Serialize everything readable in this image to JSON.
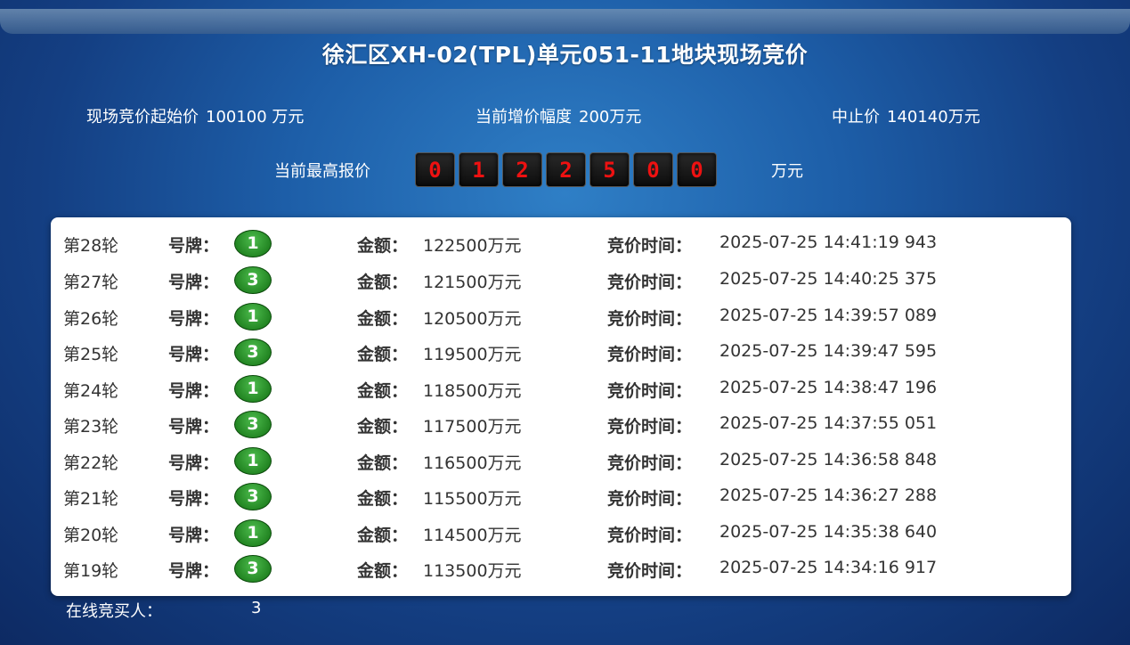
{
  "title": "徐汇区XH-02(TPL)单元051-11地块现场竞价",
  "info": {
    "start_label": "现场竞价起始价",
    "start_value": "100100 万元",
    "increment_label": "当前增价幅度",
    "increment_value": "200万元",
    "stop_label": "中止价",
    "stop_value": "140140万元"
  },
  "highest": {
    "label": "当前最高报价",
    "digits": [
      "0",
      "1",
      "2",
      "2",
      "5",
      "0",
      "0"
    ],
    "unit": "万元"
  },
  "labels": {
    "plate": "号牌：",
    "amount": "金额：",
    "time": "竞价时间："
  },
  "rounds": [
    {
      "round": "第28轮",
      "plate": "1",
      "amount": "122500万元",
      "time": "2025-07-25 14:41:19 943"
    },
    {
      "round": "第27轮",
      "plate": "3",
      "amount": "121500万元",
      "time": "2025-07-25 14:40:25 375"
    },
    {
      "round": "第26轮",
      "plate": "1",
      "amount": "120500万元",
      "time": "2025-07-25 14:39:57 089"
    },
    {
      "round": "第25轮",
      "plate": "3",
      "amount": "119500万元",
      "time": "2025-07-25 14:39:47 595"
    },
    {
      "round": "第24轮",
      "plate": "1",
      "amount": "118500万元",
      "time": "2025-07-25 14:38:47 196"
    },
    {
      "round": "第23轮",
      "plate": "3",
      "amount": "117500万元",
      "time": "2025-07-25 14:37:55 051"
    },
    {
      "round": "第22轮",
      "plate": "1",
      "amount": "116500万元",
      "time": "2025-07-25 14:36:58 848"
    },
    {
      "round": "第21轮",
      "plate": "3",
      "amount": "115500万元",
      "time": "2025-07-25 14:36:27 288"
    },
    {
      "round": "第20轮",
      "plate": "1",
      "amount": "114500万元",
      "time": "2025-07-25 14:35:38 640"
    },
    {
      "round": "第19轮",
      "plate": "3",
      "amount": "113500万元",
      "time": "2025-07-25 14:34:16 917"
    }
  ],
  "online": {
    "label": "在线竞买人：",
    "count": "3"
  }
}
